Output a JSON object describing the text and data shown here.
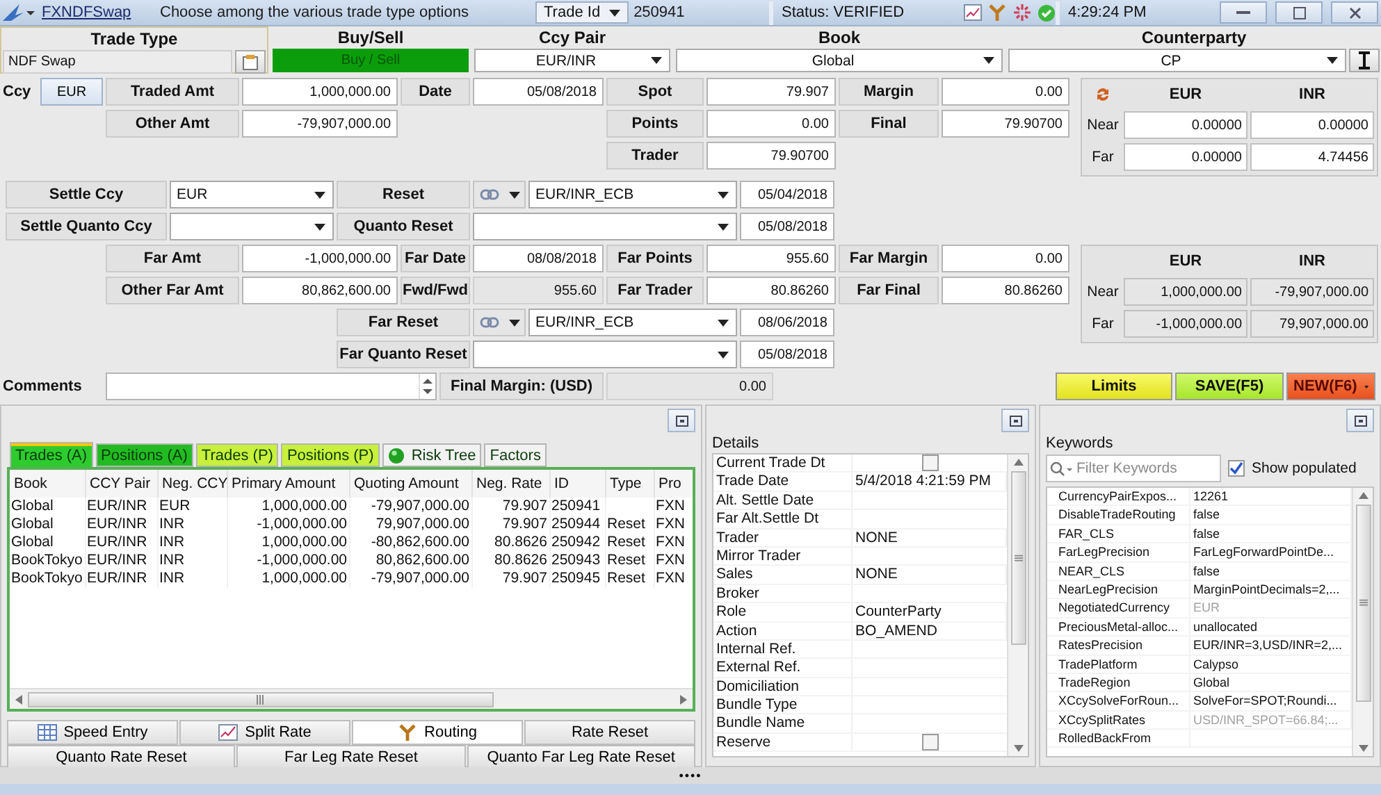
{
  "title_bar": {
    "trade_type_link": "FXNDFSwap",
    "hint": "Choose among the various trade type options",
    "id_selector": "Trade Id",
    "trade_id": "250941",
    "status": "Status: VERIFIED",
    "time": "4:29:24 PM"
  },
  "header": {
    "trade_type": {
      "label": "Trade Type",
      "value": "NDF Swap"
    },
    "buy_sell": {
      "label": "Buy/Sell",
      "value": "Buy / Sell"
    },
    "ccy_pair": {
      "label": "Ccy Pair",
      "value": "EUR/INR"
    },
    "book": {
      "label": "Book",
      "value": "Global"
    },
    "counterparty": {
      "label": "Counterparty",
      "value": "CP"
    }
  },
  "trade": {
    "ccy_label": "Ccy",
    "ccy": "EUR",
    "traded_amt": {
      "label": "Traded Amt",
      "value": "1,000,000.00"
    },
    "other_amt": {
      "label": "Other Amt",
      "value": "-79,907,000.00"
    },
    "date": {
      "label": "Date",
      "value": "05/08/2018"
    },
    "spot": {
      "label": "Spot",
      "value": "79.907"
    },
    "points": {
      "label": "Points",
      "value": "0.00"
    },
    "trader": {
      "label": "Trader",
      "value": "79.90700"
    },
    "margin": {
      "label": "Margin",
      "value": "0.00"
    },
    "final": {
      "label": "Final",
      "value": "79.90700"
    },
    "settle_ccy": {
      "label": "Settle Ccy",
      "value": "EUR"
    },
    "settle_quanto_ccy": {
      "label": "Settle Quanto Ccy"
    },
    "reset": {
      "label": "Reset",
      "value": "EUR/INR_ECB",
      "date": "05/04/2018"
    },
    "quanto_reset": {
      "label": "Quanto Reset",
      "date": "05/08/2018"
    },
    "far_amt": {
      "label": "Far Amt",
      "value": "-1,000,000.00"
    },
    "other_far_amt": {
      "label": "Other Far Amt",
      "value": "80,862,600.00"
    },
    "far_date": {
      "label": "Far Date",
      "value": "08/08/2018"
    },
    "fwd_fwd": {
      "label": "Fwd/Fwd",
      "value": "955.60"
    },
    "far_points": {
      "label": "Far Points",
      "value": "955.60"
    },
    "far_trader": {
      "label": "Far Trader",
      "value": "80.86260"
    },
    "far_margin": {
      "label": "Far Margin",
      "value": "0.00"
    },
    "far_final": {
      "label": "Far Final",
      "value": "80.86260"
    },
    "far_reset": {
      "label": "Far Reset",
      "value": "EUR/INR_ECB",
      "date": "08/06/2018"
    },
    "far_quanto_reset": {
      "label": "Far Quanto Reset",
      "date": "05/08/2018"
    },
    "comments": {
      "label": "Comments"
    },
    "final_margin": {
      "label": "Final Margin: (USD)",
      "value": "0.00"
    }
  },
  "rates_panel": {
    "columns": [
      "EUR",
      "INR"
    ],
    "rows": [
      {
        "label": "Near",
        "values": [
          "0.00000",
          "0.00000"
        ]
      },
      {
        "label": "Far",
        "values": [
          "0.00000",
          "4.74456"
        ]
      }
    ]
  },
  "amounts_panel": {
    "columns": [
      "EUR",
      "INR"
    ],
    "rows": [
      {
        "label": "Near",
        "values": [
          "1,000,000.00",
          "-79,907,000.00"
        ]
      },
      {
        "label": "Far",
        "values": [
          "-1,000,000.00",
          "79,907,000.00"
        ]
      }
    ]
  },
  "actions": [
    {
      "label": "Limits",
      "kind": "limits"
    },
    {
      "label": "SAVE(F5)",
      "kind": "save"
    },
    {
      "label": "NEW(F6)",
      "kind": "new"
    }
  ],
  "blotter": {
    "tabs": [
      {
        "label": "Trades (A)",
        "selected": true,
        "kind": "plain",
        "color": "#2ecb2e"
      },
      {
        "label": "Positions (A)",
        "selected": false,
        "kind": "plain",
        "color": "#22bb22"
      },
      {
        "label": "Trades (P)",
        "selected": false,
        "kind": "plain",
        "color": "#c8f03c"
      },
      {
        "label": "Positions (P)",
        "selected": false,
        "kind": "plain",
        "color": "#c8f03c"
      },
      {
        "label": "Risk Tree",
        "selected": false,
        "kind": "ball"
      },
      {
        "label": "Factors",
        "selected": false,
        "kind": "plain"
      }
    ],
    "columns": [
      "Book",
      "CCY Pair",
      "Neg. CCY",
      "Primary Amount",
      "Quoting Amount",
      "Neg. Rate",
      "ID",
      "Type",
      "Pro"
    ],
    "rows": [
      [
        "Global",
        "EUR/INR",
        "EUR",
        "1,000,000.00",
        "-79,907,000.00",
        "79.907",
        "250941",
        "",
        "FXN"
      ],
      [
        "Global",
        "EUR/INR",
        "INR",
        "-1,000,000.00",
        "79,907,000.00",
        "79.907",
        "250944",
        "Reset",
        "FXN"
      ],
      [
        "Global",
        "EUR/INR",
        "INR",
        "1,000,000.00",
        "-80,862,600.00",
        "80.8626",
        "250942",
        "Reset",
        "FXN"
      ],
      [
        "BookTokyo",
        "EUR/INR",
        "INR",
        "-1,000,000.00",
        "80,862,600.00",
        "80.8626",
        "250943",
        "Reset",
        "FXN"
      ],
      [
        "BookTokyo",
        "EUR/INR",
        "INR",
        "1,000,000.00",
        "-79,907,000.00",
        "79.907",
        "250945",
        "Reset",
        "FXN"
      ]
    ],
    "bottom_tabs": [
      [
        {
          "label": "Speed Entry",
          "kind": "grid",
          "selected": false
        },
        {
          "label": "Split Rate",
          "kind": "chart",
          "selected": false
        },
        {
          "label": "Routing",
          "kind": "routing",
          "selected": true
        },
        {
          "label": "Rate Reset",
          "kind": "plain",
          "selected": false
        }
      ],
      [
        {
          "label": "Quanto Rate Reset",
          "kind": "plain",
          "selected": false
        },
        {
          "label": "Far Leg Rate Reset",
          "kind": "plain",
          "selected": false
        },
        {
          "label": "Quanto Far Leg Rate Reset",
          "kind": "plain",
          "selected": false
        }
      ]
    ]
  },
  "details": {
    "title": "Details",
    "rows": [
      {
        "label": "Current Trade Dt",
        "kind": "checkbox",
        "checked": false
      },
      {
        "label": "Trade Date",
        "kind": "text",
        "value": "5/4/2018 4:21:59 PM"
      },
      {
        "label": "Alt. Settle Date",
        "kind": "text"
      },
      {
        "label": "Far Alt.Settle Dt",
        "kind": "text"
      },
      {
        "label": "Trader",
        "kind": "text",
        "value": "NONE"
      },
      {
        "label": "Mirror Trader",
        "kind": "text"
      },
      {
        "label": "Sales",
        "kind": "text",
        "value": "NONE"
      },
      {
        "label": "Broker",
        "kind": "text"
      },
      {
        "label": "Role",
        "kind": "text",
        "value": "CounterParty"
      },
      {
        "label": "Action",
        "kind": "text",
        "value": "BO_AMEND"
      },
      {
        "label": "Internal Ref.",
        "kind": "text"
      },
      {
        "label": "External Ref.",
        "kind": "text"
      },
      {
        "label": "Domiciliation",
        "kind": "text"
      },
      {
        "label": "Bundle Type",
        "kind": "text"
      },
      {
        "label": "Bundle Name",
        "kind": "text"
      },
      {
        "label": "Reserve",
        "kind": "checkbox",
        "checked": false
      }
    ]
  },
  "keywords": {
    "title": "Keywords",
    "filter": {
      "placeholder": "Filter Keywords"
    },
    "show_populated": {
      "label": "Show populated",
      "checked": true
    },
    "rows": [
      {
        "name": "CurrencyPairExpos...",
        "value": "12261",
        "dimmed": false
      },
      {
        "name": "DisableTradeRouting",
        "value": "false",
        "dimmed": false
      },
      {
        "name": "FAR_CLS",
        "value": "false",
        "dimmed": false
      },
      {
        "name": "FarLegPrecision",
        "value": "FarLegForwardPointDe...",
        "dimmed": false
      },
      {
        "name": "NEAR_CLS",
        "value": "false",
        "dimmed": false
      },
      {
        "name": "NearLegPrecision",
        "value": "MarginPointDecimals=2,...",
        "dimmed": false
      },
      {
        "name": "NegotiatedCurrency",
        "value": "EUR",
        "dimmed": true
      },
      {
        "name": "PreciousMetal-alloc...",
        "value": "unallocated",
        "dimmed": false
      },
      {
        "name": "RatesPrecision",
        "value": "EUR/INR=3,USD/INR=2,...",
        "dimmed": false
      },
      {
        "name": "TradePlatform",
        "value": "Calypso",
        "dimmed": false
      },
      {
        "name": "TradeRegion",
        "value": "Global",
        "dimmed": false
      },
      {
        "name": "XCcySolveForRoun...",
        "value": "SolveFor=SPOT;Roundi...",
        "dimmed": false
      },
      {
        "name": "XCcySplitRates",
        "value": "USD/INR_SPOT=66.84;...",
        "dimmed": true
      },
      {
        "name": "RolledBackFrom",
        "dimmed": false
      }
    ]
  },
  "status_bar": {
    "grip": "••••"
  }
}
